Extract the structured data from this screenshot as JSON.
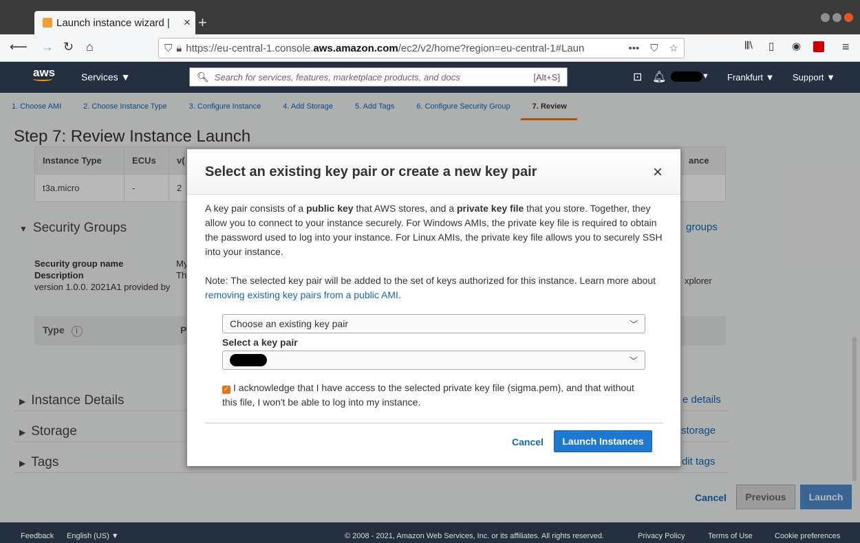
{
  "browser": {
    "tab_title": "Launch instance wizard |",
    "url_prefix": "https://eu-central-1.console.",
    "url_domain": "aws.amazon.com",
    "url_rest": "/ec2/v2/home?region=eu-central-1#Laun",
    "url_more": "•••"
  },
  "aws": {
    "logo": "aws",
    "services": "Services ▼",
    "search_placeholder": "Search for services, features, marketplace products, and docs",
    "search_shortcut": "[Alt+S]",
    "region": "Frankfurt ▼",
    "support": "Support ▼"
  },
  "steps": [
    "1. Choose AMI",
    "2. Choose Instance Type",
    "3. Configure Instance",
    "4. Add Storage",
    "5. Add Tags",
    "6. Configure Security Group",
    "7. Review"
  ],
  "page": {
    "title": "Step 7: Review Instance Launch",
    "table_headers": [
      "Instance Type",
      "ECUs",
      "v("
    ],
    "table_tail_header": "ance",
    "table_row": [
      "t3a.micro",
      "-",
      "2"
    ],
    "security_groups": "Security Groups",
    "security_groups_link": "groups",
    "sg_name_label": "Security group name",
    "sg_name_value": "My",
    "sg_desc_label": "Description",
    "sg_desc_value": "Th",
    "sg_desc_tail": "xplorer",
    "sg_version": "version 1.0.0. 2021A1 provided by",
    "type_header": "Type",
    "type_header2": "P",
    "instance_details": "Instance Details",
    "instance_details_link": "e details",
    "storage": "Storage",
    "storage_link": "storage",
    "tags": "Tags",
    "tags_link": "dit tags",
    "cancel": "Cancel",
    "previous": "Previous",
    "launch": "Launch"
  },
  "modal": {
    "title": "Select an existing key pair or create a new key pair",
    "close": "×",
    "para1_a": "A key pair consists of a ",
    "para1_b": "public key",
    "para1_c": " that AWS stores, and a ",
    "para1_d": "private key file",
    "para1_e": " that you store. Together, they allow you to connect to your instance securely. For Windows AMIs, the private key file is required to obtain the password used to log into your instance. For Linux AMIs, the private key file allows you to securely SSH into your instance.",
    "note_a": "Note: The selected key pair will be added to the set of keys authorized for this instance. Learn more about ",
    "note_link": "removing existing key pairs from a public AMI",
    "note_end": ".",
    "select_mode": "Choose an existing key pair",
    "select_label": "Select a key pair",
    "ack": "I acknowledge that I have access to the selected private key file (sigma.pem), and that without this file, I won't be able to log into my instance.",
    "cancel": "Cancel",
    "launch": "Launch Instances"
  },
  "footer": {
    "feedback": "Feedback",
    "language": "English (US) ▼",
    "copyright": "© 2008 - 2021, Amazon Web Services, Inc. or its affiliates. All rights reserved.",
    "privacy": "Privacy Policy",
    "terms": "Terms of Use",
    "cookies": "Cookie preferences"
  }
}
